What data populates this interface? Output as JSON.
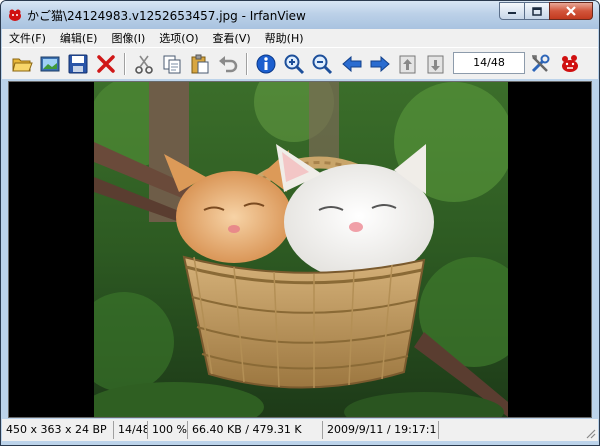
{
  "window": {
    "title": "かご猫\\24124983.v1252653457.jpg - IrfanView"
  },
  "title_buttons": {
    "minimize": "minimize-icon",
    "maximize": "maximize-icon",
    "close": "close-icon"
  },
  "menu": {
    "items": [
      {
        "label": "文件(F)"
      },
      {
        "label": "编辑(E)"
      },
      {
        "label": "图像(I)"
      },
      {
        "label": "选项(O)"
      },
      {
        "label": "查看(V)"
      },
      {
        "label": "帮助(H)"
      }
    ]
  },
  "toolbar": {
    "page_indicator": "14/48",
    "icons": [
      "open-folder-icon",
      "slideshow-icon",
      "save-icon",
      "delete-icon",
      "cut-icon",
      "copy-icon",
      "paste-icon",
      "undo-icon",
      "info-icon",
      "zoom-in-icon",
      "zoom-out-icon",
      "prev-arrow-icon",
      "next-arrow-icon",
      "prev-page-icon",
      "next-page-icon",
      "settings-icon",
      "exit-icon"
    ]
  },
  "status": {
    "dimensions": "450 x 363 x 24 BP",
    "index": "14/48",
    "zoom": "100 %",
    "filesize": "66.40 KB / 479.31 K",
    "datetime": "2009/9/11 / 19:17:1"
  },
  "colors": {
    "titlebar": "#bcd1e8",
    "menubar": "#f0f0f0",
    "viewer_bg": "#000000",
    "close_button": "#c23a1f"
  }
}
